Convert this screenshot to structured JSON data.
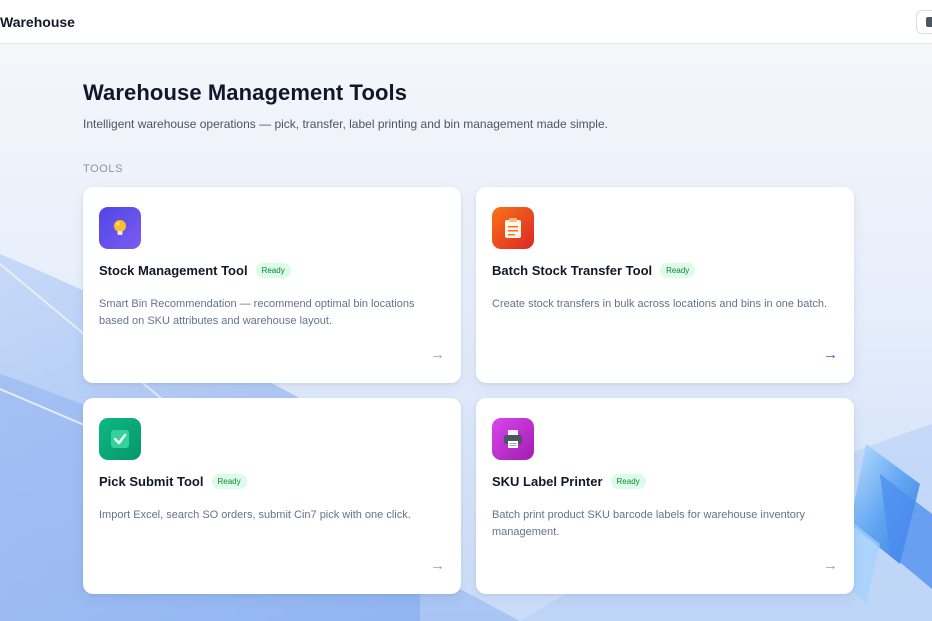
{
  "topbar": {
    "brand": "Warehouse",
    "action_icon": "app-icon"
  },
  "header": {
    "title": "Warehouse Management Tools",
    "subtitle": "Intelligent warehouse operations — pick, transfer, label printing and bin management made simple."
  },
  "section": {
    "label": "TOOLS"
  },
  "cards": [
    {
      "title": "Stock Management Tool",
      "badge": "Ready",
      "description": "Smart Bin Recommendation — recommend optimal bin locations based on SKU attributes and warehouse layout.",
      "arrow": "→",
      "icon": "lightbulb-icon",
      "icon_color": "#5b5ce6"
    },
    {
      "title": "Batch Stock Transfer Tool",
      "badge": "Ready",
      "description": "Create stock transfers in bulk across locations and bins in one batch.",
      "arrow": "→",
      "icon": "clipboard-icon",
      "icon_color": "#ea580c"
    },
    {
      "title": "Pick Submit Tool",
      "badge": "Ready",
      "description": "Import Excel, search SO orders, submit Cin7 pick with one click.",
      "arrow": "→",
      "icon": "checkmark-icon",
      "icon_color": "#10b981"
    },
    {
      "title": "SKU Label Printer",
      "badge": "Ready",
      "description": "Batch print product SKU barcode labels for warehouse inventory management.",
      "arrow": "→",
      "icon": "printer-icon",
      "icon_color": "#c026d3"
    }
  ],
  "colors": {
    "badge_bg": "#dcfce7",
    "badge_text": "#15803d",
    "accent_arrow": "#2563eb"
  }
}
